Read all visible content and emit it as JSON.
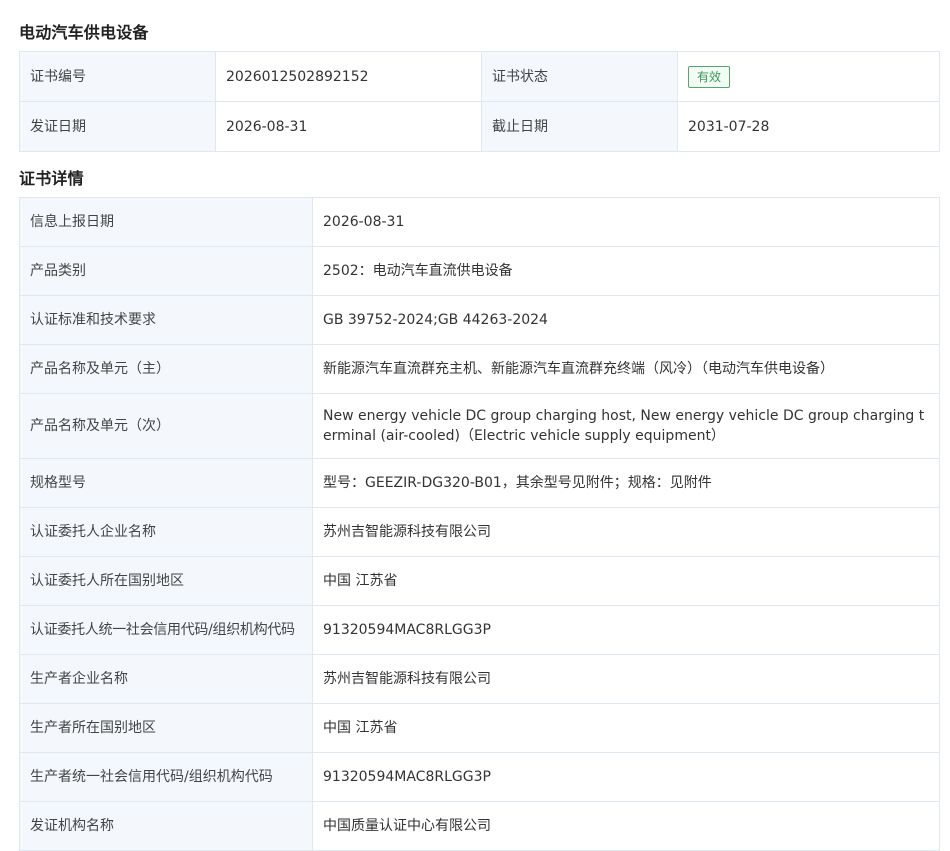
{
  "summary": {
    "title": "电动汽车供电设备",
    "rows": [
      {
        "label1": "证书编号",
        "value1": "2026012502892152",
        "label2": "证书状态",
        "status": "有效"
      },
      {
        "label1": "发证日期",
        "value1": "2026-08-31",
        "label2": "截止日期",
        "value2": "2031-07-28"
      }
    ]
  },
  "details": {
    "title": "证书详情",
    "rows": [
      {
        "label": "信息上报日期",
        "value": "2026-08-31"
      },
      {
        "label": "产品类别",
        "value": "2502：电动汽车直流供电设备"
      },
      {
        "label": "认证标准和技术要求",
        "value": "GB 39752-2024;GB 44263-2024"
      },
      {
        "label": "产品名称及单元（主）",
        "value": "新能源汽车直流群充主机、新能源汽车直流群充终端（风冷）（电动汽车供电设备）"
      },
      {
        "label": "产品名称及单元（次）",
        "value": "New energy vehicle DC group charging host, New energy vehicle DC group charging terminal (air-cooled)（Electric vehicle supply equipment）"
      },
      {
        "label": "规格型号",
        "value": "型号：GEEZIR-DG320-B01，其余型号见附件；规格：见附件"
      },
      {
        "label": "认证委托人企业名称",
        "value": "苏州吉智能源科技有限公司"
      },
      {
        "label": "认证委托人所在国别地区",
        "value": "中国 江苏省"
      },
      {
        "label": "认证委托人统一社会信用代码/组织机构代码",
        "value": "91320594MAC8RLGG3P"
      },
      {
        "label": "生产者企业名称",
        "value": "苏州吉智能源科技有限公司"
      },
      {
        "label": "生产者所在国别地区",
        "value": "中国 江苏省"
      },
      {
        "label": "生产者统一社会信用代码/组织机构代码",
        "value": "91320594MAC8RLGG3P"
      },
      {
        "label": "发证机构名称",
        "value": "中国质量认证中心有限公司"
      }
    ]
  },
  "colors": {
    "label_bg": "#f4f8fd",
    "border": "#dfe7f1",
    "status_green": "#3a9a58"
  }
}
